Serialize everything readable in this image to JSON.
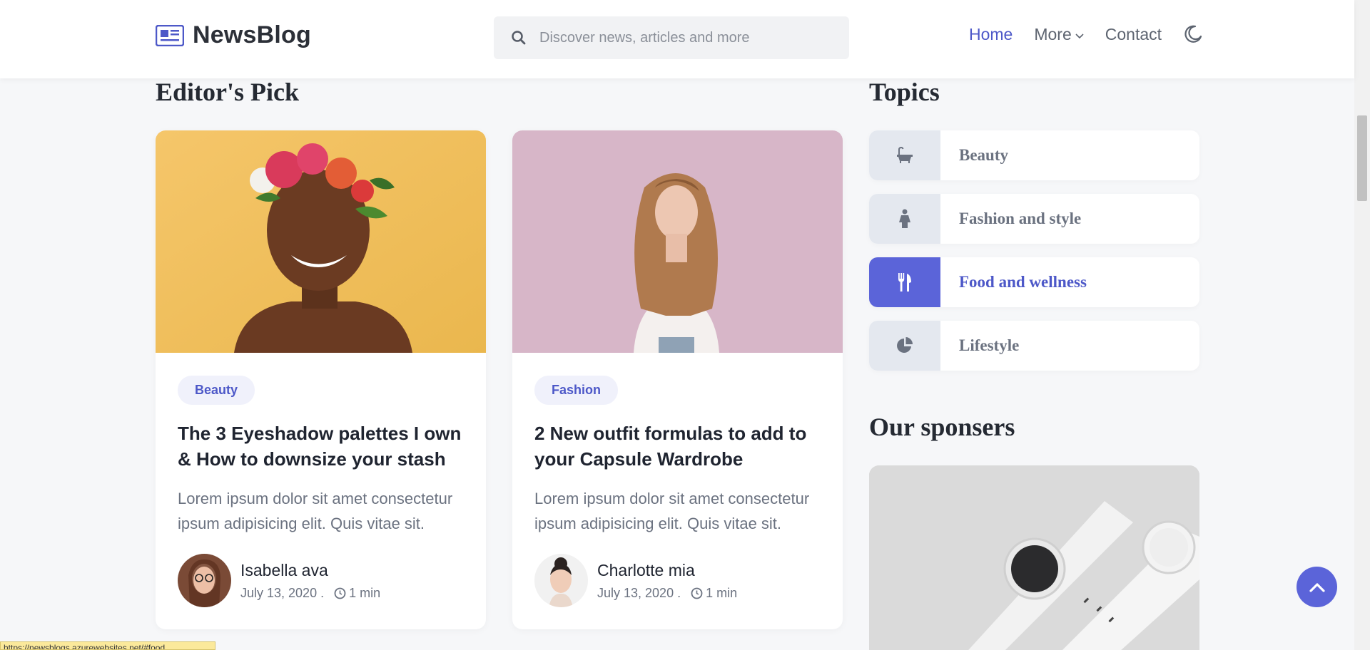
{
  "header": {
    "logo_text": "NewsBlog",
    "search_placeholder": "Discover news, articles and more",
    "nav": [
      {
        "label": "Home",
        "active": true
      },
      {
        "label": "More",
        "dropdown": true
      },
      {
        "label": "Contact"
      }
    ]
  },
  "editors_pick": {
    "heading": "Editor's Pick",
    "cards": [
      {
        "tag": "Beauty",
        "title": "The 3 Eyeshadow palettes I own & How to downsize your stash",
        "excerpt": "Lorem ipsum dolor sit amet consectetur ipsum adipisicing elit. Quis vitae sit.",
        "author": "Isabella ava",
        "date": "July 13, 2020 .",
        "read_time": "1 min"
      },
      {
        "tag": "Fashion",
        "title": "2 New outfit formulas to add to your Capsule Wardrobe",
        "excerpt": "Lorem ipsum dolor sit amet consectetur ipsum adipisicing elit. Quis vitae sit.",
        "author": "Charlotte mia",
        "date": "July 13, 2020 .",
        "read_time": "1 min"
      }
    ]
  },
  "topics": {
    "heading": "Topics",
    "items": [
      {
        "label": "Beauty",
        "icon": "bath-icon"
      },
      {
        "label": "Fashion and style",
        "icon": "person-icon"
      },
      {
        "label": "Food and wellness",
        "icon": "utensils-icon",
        "active": true
      },
      {
        "label": "Lifestyle",
        "icon": "pie-chart-icon"
      }
    ]
  },
  "sponsors": {
    "heading": "Our sponsers"
  },
  "status_bar": {
    "url": "https://newsblogs.azurewebsites.net/#food"
  },
  "colors": {
    "accent": "#5b64d9",
    "accent_text": "#4d58c8",
    "background": "#f6f7f9"
  }
}
